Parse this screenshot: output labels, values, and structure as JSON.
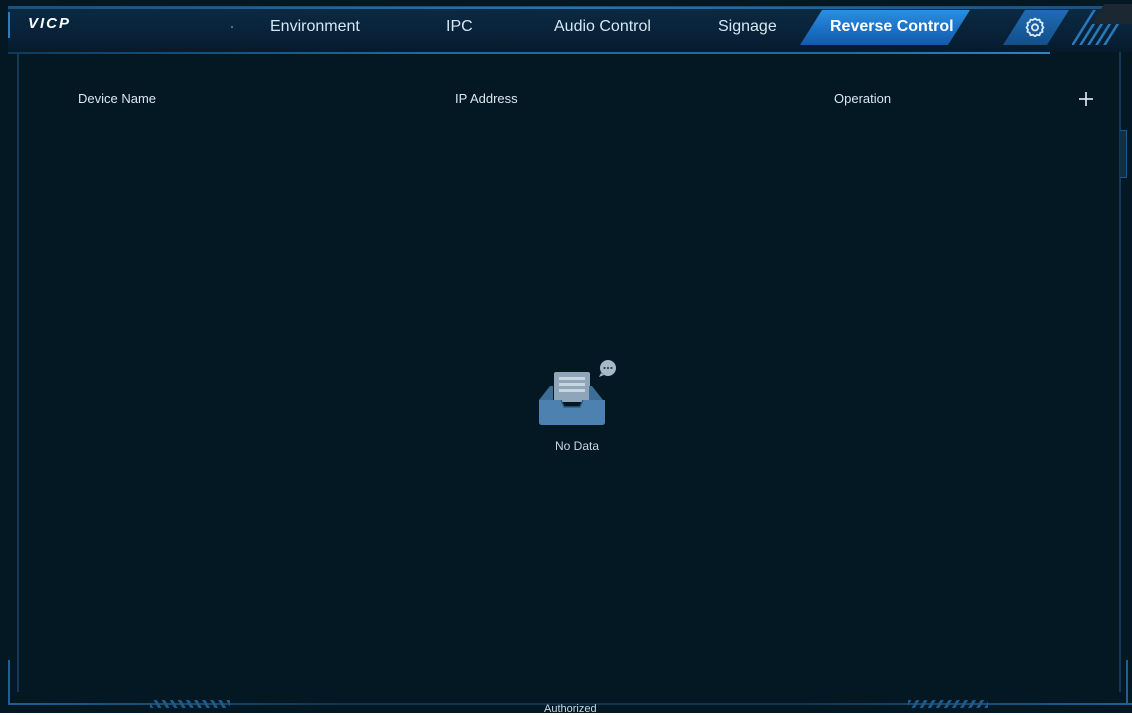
{
  "app": {
    "logo": "VICP"
  },
  "nav": {
    "items": [
      {
        "label": "Environment"
      },
      {
        "label": "IPC"
      },
      {
        "label": "Audio Control"
      },
      {
        "label": "Signage"
      },
      {
        "label": "Reverse Control",
        "active": true
      }
    ],
    "settings_icon": "gear-icon"
  },
  "table": {
    "columns": [
      "Device Name",
      "IP Address",
      "Operation"
    ],
    "add_icon": "plus-icon",
    "rows": []
  },
  "empty_state": {
    "icon": "empty-inbox-icon",
    "text": "No Data"
  },
  "footer": {
    "status": "Authorized"
  },
  "colors": {
    "background": "#041824",
    "accent": "#1a6ec4",
    "text": "#dbe6ef"
  }
}
